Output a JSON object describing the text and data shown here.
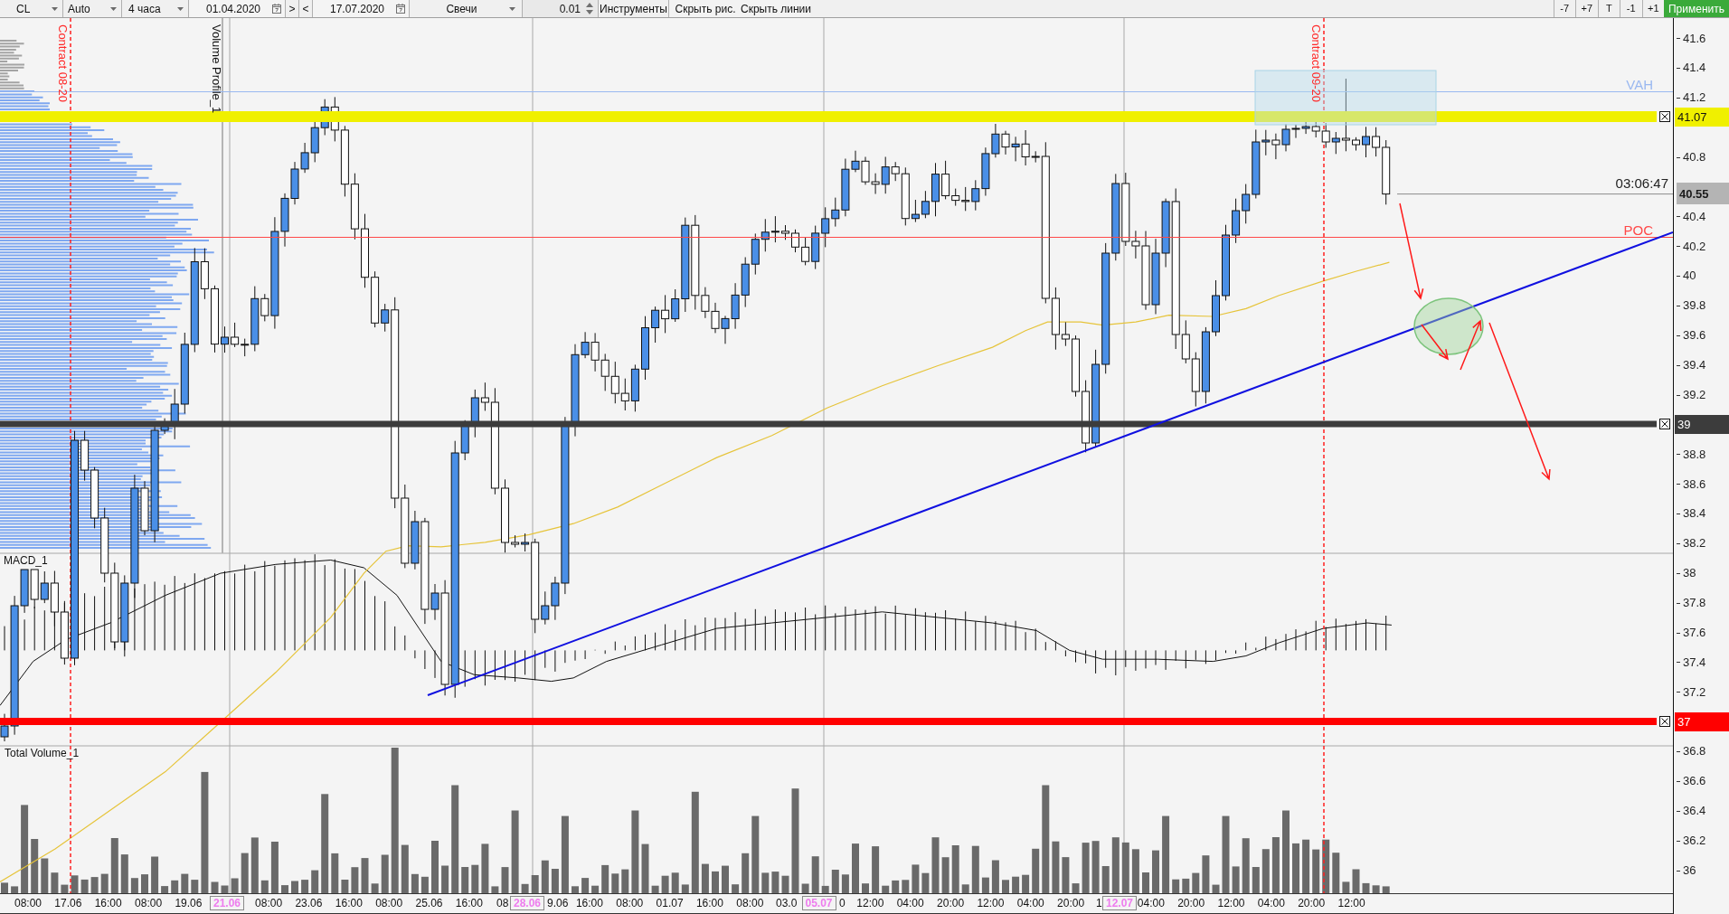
{
  "toolbar": {
    "symbol": "CL",
    "aggregation": "Auto",
    "timeframe": "4 часа",
    "date_from": "01.04.2020",
    "range_buttons": [
      ">",
      "<"
    ],
    "date_to": "17.07.2020",
    "chart_type": "Свечи",
    "tick_step": "0.01",
    "tools_button": "Инструменты",
    "hide_buttons": [
      "Скрыть рис.",
      "Скрыть линии"
    ],
    "shift_buttons": [
      "-7",
      "+7",
      "T",
      "-1",
      "+1"
    ],
    "apply_button": "Применить"
  },
  "chart": {
    "contract_markers": [
      "Contract 08-20",
      "Contract 09-20"
    ],
    "volume_profile_label": "Volume Profile_1",
    "macd_label": "MACD_1",
    "volume_label": "Total Volume_1",
    "profile_levels": [
      {
        "label": "VAH",
        "color": "#9ab8f0"
      },
      {
        "label": "POC",
        "color": "#ff4848"
      }
    ],
    "price_lines": [
      {
        "price": "41.07",
        "color": "#f0f000"
      },
      {
        "price": "39",
        "color": "#3c3c3c"
      },
      {
        "price": "37",
        "color": "#ff0000"
      }
    ],
    "last_price": {
      "price": "40.55",
      "countdown": "03:06:47"
    },
    "price_axis": [
      "41.6",
      "41.4",
      "41.2",
      "40.8",
      "40.4",
      "40.2",
      "40",
      "39.8",
      "39.6",
      "39.4",
      "39.2",
      "38.8",
      "38.6",
      "38.4",
      "38.2",
      "38",
      "37.8",
      "37.6",
      "37.4",
      "37.2",
      "36.8",
      "36.6",
      "36.4",
      "36.2",
      "36"
    ],
    "time_axis": [
      {
        "text": "08:00",
        "highlighted": false
      },
      {
        "text": "17.06",
        "highlighted": false
      },
      {
        "text": "16:00",
        "highlighted": false
      },
      {
        "text": "08:00",
        "highlighted": false
      },
      {
        "text": "19.06",
        "highlighted": false
      },
      {
        "text": "21.06",
        "highlighted": true
      },
      {
        "text": "08:00",
        "highlighted": false
      },
      {
        "text": "23.06",
        "highlighted": false
      },
      {
        "text": "16:00",
        "highlighted": false
      },
      {
        "text": "08:00",
        "highlighted": false
      },
      {
        "text": "25.06",
        "highlighted": false
      },
      {
        "text": "16:00",
        "highlighted": false
      },
      {
        "text": "08",
        "highlighted": false
      },
      {
        "text": "28.06",
        "highlighted": true
      },
      {
        "text": "9.06",
        "highlighted": false
      },
      {
        "text": "16:00",
        "highlighted": false
      },
      {
        "text": "08:00",
        "highlighted": false
      },
      {
        "text": "01.07",
        "highlighted": false
      },
      {
        "text": "16:00",
        "highlighted": false
      },
      {
        "text": "08:00",
        "highlighted": false
      },
      {
        "text": "03.0",
        "highlighted": false
      },
      {
        "text": "05.07",
        "highlighted": true
      },
      {
        "text": "0",
        "highlighted": false
      },
      {
        "text": "12:00",
        "highlighted": false
      },
      {
        "text": "04:00",
        "highlighted": false
      },
      {
        "text": "20:00",
        "highlighted": false
      },
      {
        "text": "12:00",
        "highlighted": false
      },
      {
        "text": "04:00",
        "highlighted": false
      },
      {
        "text": "20:00",
        "highlighted": false
      },
      {
        "text": "1",
        "highlighted": false
      },
      {
        "text": "12.07",
        "highlighted": true
      },
      {
        "text": "04:00",
        "highlighted": false
      },
      {
        "text": "20:00",
        "highlighted": false
      },
      {
        "text": "12:00",
        "highlighted": false
      },
      {
        "text": "04:00",
        "highlighted": false
      },
      {
        "text": "20:00",
        "highlighted": false
      },
      {
        "text": "12:00",
        "highlighted": false
      }
    ]
  }
}
